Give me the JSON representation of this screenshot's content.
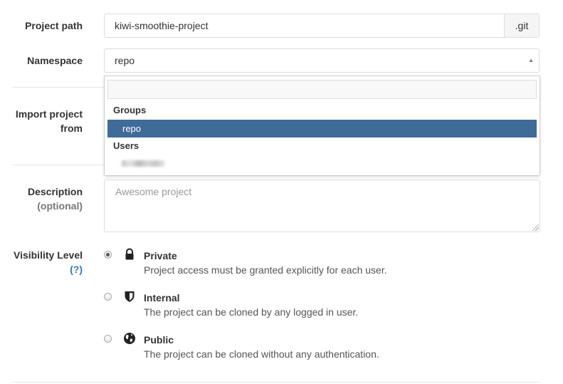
{
  "project_path": {
    "label": "Project path",
    "value": "kiwi-smoothie-project",
    "suffix": ".git"
  },
  "namespace": {
    "label": "Namespace",
    "value": "repo",
    "dropdown": {
      "search_value": "",
      "groups_header": "Groups",
      "selected_option": "repo",
      "users_header": "Users"
    }
  },
  "import_project": {
    "label_line1": "Import project",
    "label_line2": "from"
  },
  "description": {
    "label": "Description",
    "optional": "(optional)",
    "placeholder": "Awesome project"
  },
  "visibility": {
    "label": "Visibility Level",
    "help": "(?)",
    "options": [
      {
        "icon": "lock-icon",
        "title": "Private",
        "description": "Project access must be granted explicitly for each user.",
        "checked": true
      },
      {
        "icon": "shield-icon",
        "title": "Internal",
        "description": "The project can be cloned by any logged in user.",
        "checked": false
      },
      {
        "icon": "globe-icon",
        "title": "Public",
        "description": "The project can be cloned without any authentication.",
        "checked": false
      }
    ]
  }
}
